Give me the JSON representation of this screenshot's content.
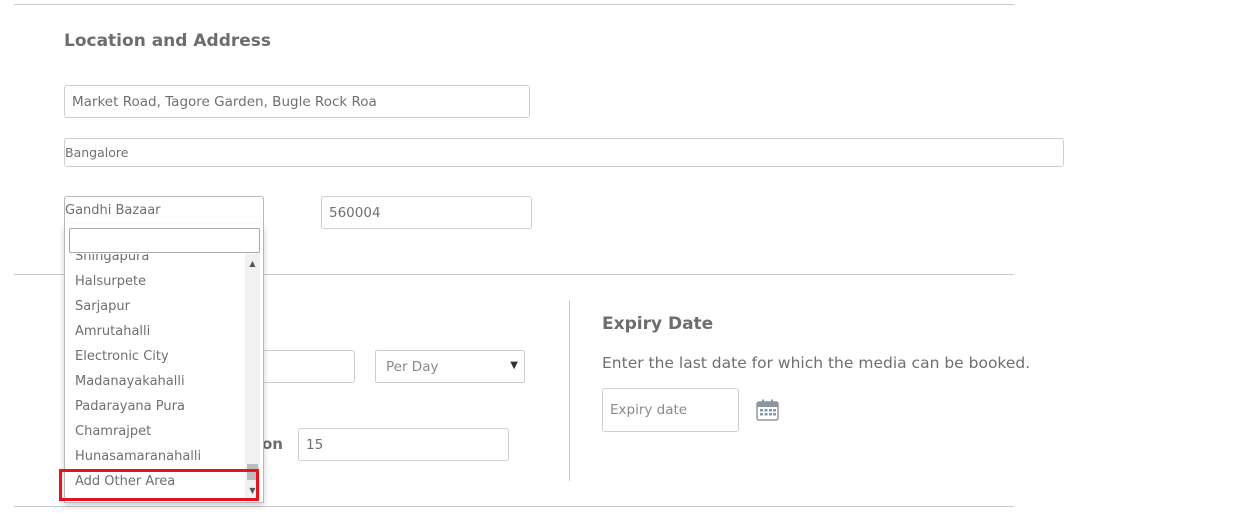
{
  "location": {
    "title": "Location and Address",
    "address_line": "Market Road, Tagore Garden, Bugle Rock Roa",
    "city": "Bangalore",
    "pincode": "560004"
  },
  "area_dropdown": {
    "selected": "Gandhi Bazaar",
    "search_value": "",
    "options": [
      "Shingapura",
      "Halsurpete",
      "Sarjapur",
      "Amrutahalli",
      "Electronic City",
      "Madanayakahalli",
      "Padarayana Pura",
      "Chamrajpet",
      "Hunasamaranahalli",
      "Add Other Area"
    ],
    "highlighted_option": "Add Other Area"
  },
  "pricing": {
    "rate_unit": "Per Day",
    "partial_label_tail": "on",
    "min_duration_value": "15"
  },
  "expiry": {
    "title": "Expiry Date",
    "description": "Enter the last date for which the media can be booked.",
    "date_placeholder": "Expiry date",
    "icon": "calendar-icon"
  },
  "colors": {
    "highlight": "#e3141d"
  }
}
